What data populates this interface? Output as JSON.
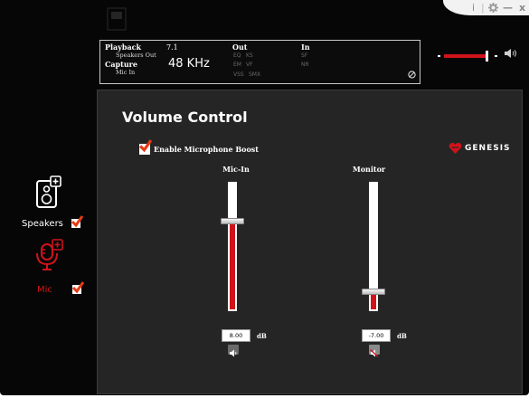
{
  "window": {
    "info_icon": "i",
    "settings_icon": "gear-icon",
    "minimize_icon": "—",
    "close_icon": "x"
  },
  "info": {
    "playback": {
      "label": "Playback",
      "device": "Speakers Out",
      "channels": "7.1"
    },
    "capture": {
      "label": "Capture",
      "device": "Mic In",
      "rate": "48 KHz"
    },
    "out": {
      "label": "Out",
      "flags": [
        "EQ",
        "KS",
        "EM",
        "VF",
        "VSS",
        "SMX"
      ]
    },
    "in": {
      "label": "In",
      "flags": [
        "SF",
        "NR"
      ]
    }
  },
  "master_volume": {
    "level": 0.82,
    "accent": "#d0131a"
  },
  "sidebar": {
    "speakers": {
      "label": "Speakers",
      "checked": true
    },
    "mic": {
      "label": "Mic",
      "checked": true,
      "active": true
    }
  },
  "panel": {
    "title": "Volume Control",
    "boost_label": "Enable Microphone Boost",
    "boost_checked": true,
    "brand": "GENESIS",
    "channels": [
      {
        "id": "mic-in",
        "label": "Mic-In",
        "value": "8.00",
        "unit": "dB",
        "level": 0.7,
        "muted": false
      },
      {
        "id": "monitor",
        "label": "Monitor",
        "value": "-7.00",
        "unit": "dB",
        "level": 0.14,
        "muted": true
      }
    ]
  },
  "colors": {
    "accent": "#d0131a",
    "panel": "#252525",
    "background": "#060606"
  }
}
